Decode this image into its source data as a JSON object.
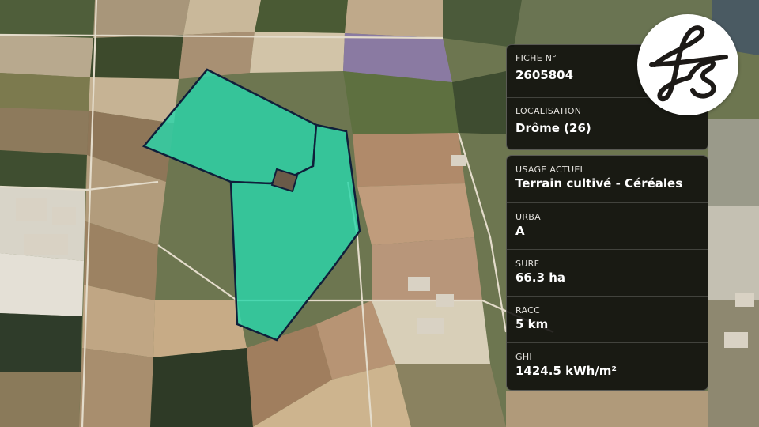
{
  "brand": {
    "logo_text": "fs"
  },
  "map": {
    "parcel_color": "#2ad6aa",
    "parcel_border": "#0f1f3a"
  },
  "fiche": {
    "label": "FICHE N°",
    "value": "2605804"
  },
  "localisation": {
    "label": "LOCALISATION",
    "value": "Drôme (26)"
  },
  "usage": {
    "label": "USAGE ACTUEL",
    "value": "Terrain cultivé - Céréales"
  },
  "urba": {
    "label": "URBA",
    "value": "A"
  },
  "surf": {
    "label": "SURF",
    "value": "66.3 ha"
  },
  "racc": {
    "label": "RACC",
    "value": "5 km"
  },
  "ghi": {
    "label": "GHI",
    "value": "1424.5 kWh/m²"
  }
}
